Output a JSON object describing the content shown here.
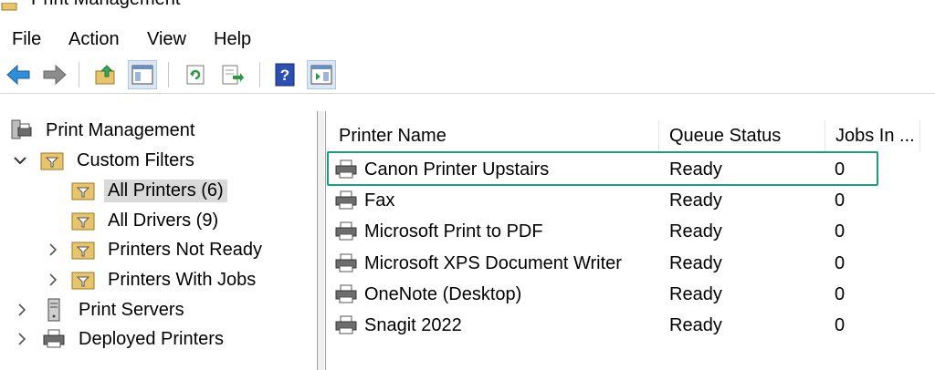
{
  "window": {
    "title": "Print Management"
  },
  "menu": [
    "File",
    "Action",
    "View",
    "Help"
  ],
  "toolbar": {
    "buttons": [
      "back-icon",
      "forward-icon",
      "up-folder-icon",
      "show-hide-tree-icon",
      "refresh-icon",
      "export-list-icon",
      "help-icon",
      "show-hide-action-pane-icon"
    ]
  },
  "tree": {
    "root": "Print Management",
    "custom_filters": "Custom Filters",
    "all_printers": "All Printers (6)",
    "all_drivers": "All Drivers (9)",
    "printers_not_ready": "Printers Not Ready",
    "printers_with_jobs": "Printers With Jobs",
    "print_servers": "Print Servers",
    "deployed_printers": "Deployed Printers"
  },
  "list": {
    "columns": [
      "Printer Name",
      "Queue Status",
      "Jobs In ..."
    ],
    "rows": [
      {
        "name": "Canon Printer Upstairs",
        "status": "Ready",
        "jobs": "0"
      },
      {
        "name": "Fax",
        "status": "Ready",
        "jobs": "0"
      },
      {
        "name": "Microsoft Print to PDF",
        "status": "Ready",
        "jobs": "0"
      },
      {
        "name": "Microsoft XPS Document Writer",
        "status": "Ready",
        "jobs": "0"
      },
      {
        "name": "OneNote (Desktop)",
        "status": "Ready",
        "jobs": "0"
      },
      {
        "name": "Snagit 2022",
        "status": "Ready",
        "jobs": "0"
      }
    ]
  },
  "colors": {
    "highlight": "#1f9b7e",
    "selection": "#d9d9d9"
  }
}
